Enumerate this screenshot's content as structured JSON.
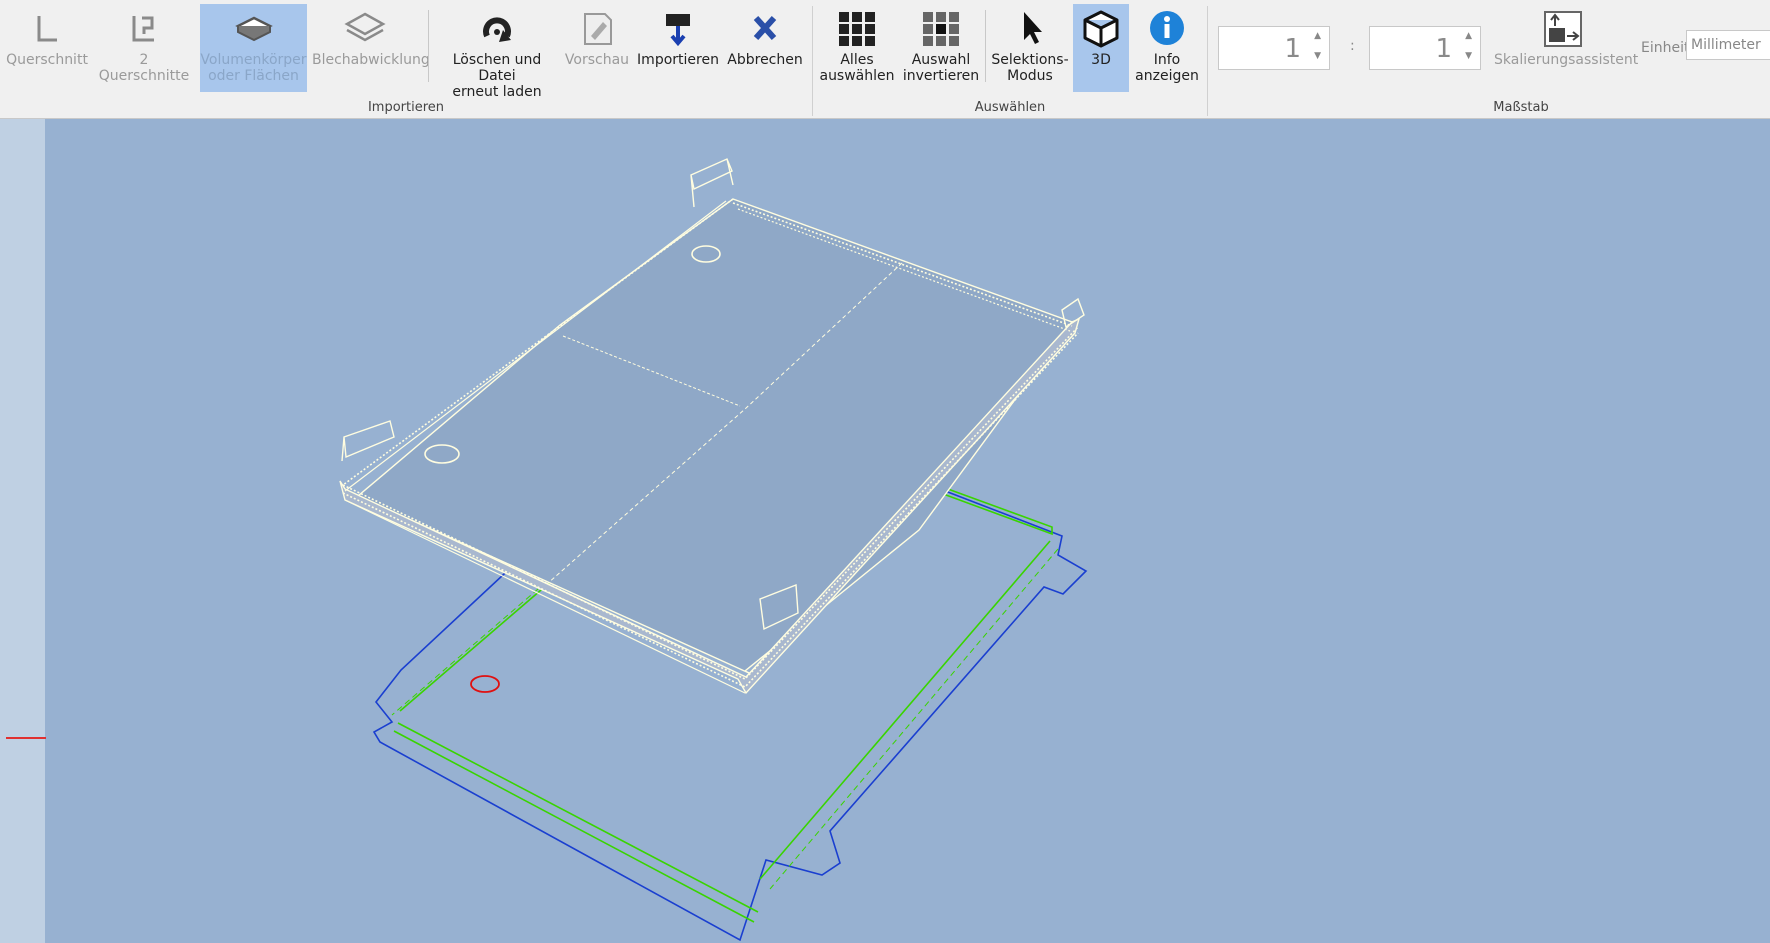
{
  "toolbar": {
    "import_group": {
      "label": "Importieren",
      "buttons": [
        {
          "label": "Querschnitt",
          "icon": "cross-section-icon",
          "disabled": true
        },
        {
          "label": "2 Querschnitte",
          "icon": "two-cross-sections-icon",
          "disabled": true
        },
        {
          "label": "Volumenkörper\noder Flächen",
          "icon": "solid-body-icon",
          "disabled": true,
          "active": true
        },
        {
          "label": "Blechabwicklung",
          "icon": "sheet-unfold-icon",
          "disabled": true
        },
        {
          "label": "Löschen und Datei\nerneut laden",
          "icon": "reload-icon"
        },
        {
          "label": "Vorschau",
          "icon": "preview-icon",
          "disabled": true
        },
        {
          "label": "Importieren",
          "icon": "import-icon"
        },
        {
          "label": "Abbrechen",
          "icon": "close-icon"
        }
      ]
    },
    "select_group": {
      "label": "Auswählen",
      "buttons": [
        {
          "label": "Alles\nauswählen",
          "icon": "select-all-icon"
        },
        {
          "label": "Auswahl\ninvertieren",
          "icon": "invert-selection-icon"
        },
        {
          "label": "Selektions-\nModus",
          "icon": "cursor-icon"
        },
        {
          "label": "3D",
          "icon": "cube-icon",
          "active": true
        },
        {
          "label": "Info\nanzeigen",
          "icon": "info-icon"
        }
      ]
    },
    "scale_group": {
      "label": "Maßstab",
      "scale_left": "1",
      "colon": ":",
      "scale_right": "1",
      "assistant_label": "Skalierungsassistent",
      "assistant_icon": "scale-assistant-icon",
      "unit_label": "Einheit",
      "unit_value": "Millimeter"
    }
  },
  "colors": {
    "viewport_bg": "#97b1d1",
    "model_edges": "#fffde0",
    "outline_blue": "#1a3fd0",
    "bend_green": "#39d400",
    "hole_red": "#e01010",
    "active_button": "#a8c6ec"
  }
}
